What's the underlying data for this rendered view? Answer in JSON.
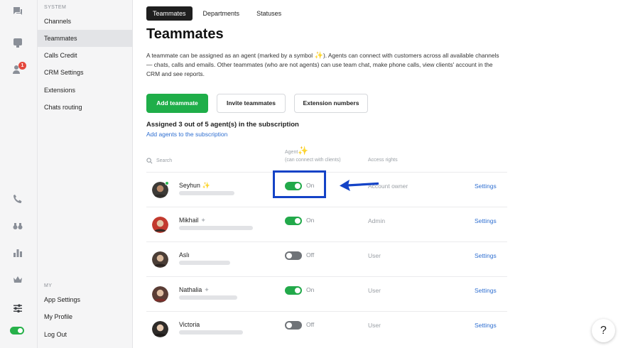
{
  "sidebar": {
    "system_label": "SYSTEM",
    "system_items": [
      {
        "label": "Channels"
      },
      {
        "label": "Teammates"
      },
      {
        "label": "Calls Credit"
      },
      {
        "label": "CRM Settings"
      },
      {
        "label": "Extensions"
      },
      {
        "label": "Chats routing"
      }
    ],
    "my_label": "MY",
    "my_items": [
      {
        "label": "App Settings"
      },
      {
        "label": "My Profile"
      },
      {
        "label": "Log Out"
      }
    ]
  },
  "rail": {
    "notification_count": "1"
  },
  "tabs": [
    {
      "label": "Teammates"
    },
    {
      "label": "Departments"
    },
    {
      "label": "Statuses"
    }
  ],
  "page": {
    "title": "Teammates",
    "desc_before": "A teammate can be assigned as an agent (marked by a symbol ",
    "desc_after": "). Agents can connect with customers across all available channels — chats, calls and emails. Other teammates (who are not agents) can use team chat, make phone calls, view clients' account in the CRM and see reports."
  },
  "buttons": {
    "add": "Add teammate",
    "invite": "Invite teammates",
    "extensions": "Extension numbers"
  },
  "subscription": {
    "assigned": "Assigned 3 out of 5 agent(s) in the subscription",
    "add_link": "Add agents to the subscription"
  },
  "columns": {
    "search": "Search",
    "agent": "Agent",
    "agent_sub": "(can connect with clients)",
    "access": "Access rights"
  },
  "teammates": [
    {
      "name": "Seyhun",
      "agent": "On",
      "access": "Account owner",
      "settings": "Settings"
    },
    {
      "name": "Mikhail",
      "agent": "On",
      "access": "Admin",
      "settings": "Settings"
    },
    {
      "name": "Aslı",
      "agent": "Off",
      "access": "User",
      "settings": "Settings"
    },
    {
      "name": "Nathalia",
      "agent": "On",
      "access": "User",
      "settings": "Settings"
    },
    {
      "name": "Victoria",
      "agent": "Off",
      "access": "User",
      "settings": "Settings"
    }
  ],
  "help": "?",
  "colors": {
    "primary": "#1fae49",
    "link": "#2f6fd1",
    "highlight": "#1443c7",
    "agent_symbol": "#f2b824"
  }
}
